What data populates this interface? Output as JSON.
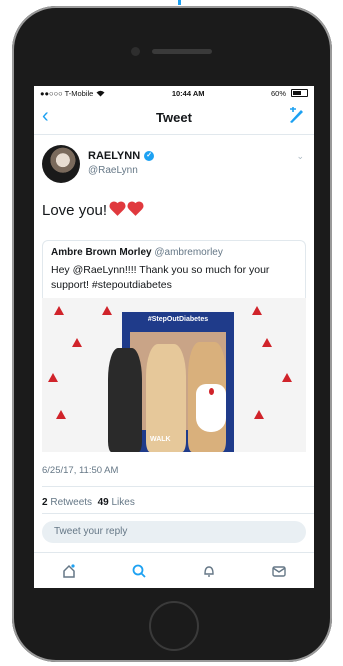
{
  "status_bar": {
    "carrier": "●●○○○ T-Mobile",
    "time": "10:44 AM",
    "battery": "60%"
  },
  "nav": {
    "title": "Tweet",
    "back_icon": "chevron-left-icon",
    "compose_icon": "compose-icon"
  },
  "tweet": {
    "name": "RAELYNN",
    "handle": "@RaeLynn",
    "text": "Love you!",
    "timestamp": "6/25/17, 11:50 AM",
    "retweets_count": "2",
    "retweets_label": "Retweets",
    "likes_count": "49",
    "likes_label": "Likes"
  },
  "quoted": {
    "name": "Ambre Brown Morley",
    "handle": "@ambremorley",
    "text": "Hey @RaeLynn!!!! Thank you so much for your support! #stepoutdiabetes",
    "photo_frame_label": "#StepOutDiabetes",
    "photo_walk_label": "WALK"
  },
  "reply": {
    "placeholder": "Tweet your reply"
  },
  "tabs": [
    "home-icon",
    "search-icon",
    "notifications-icon",
    "messages-icon"
  ],
  "colors": {
    "accent": "#1da1f2",
    "heart": "#e0393e"
  }
}
